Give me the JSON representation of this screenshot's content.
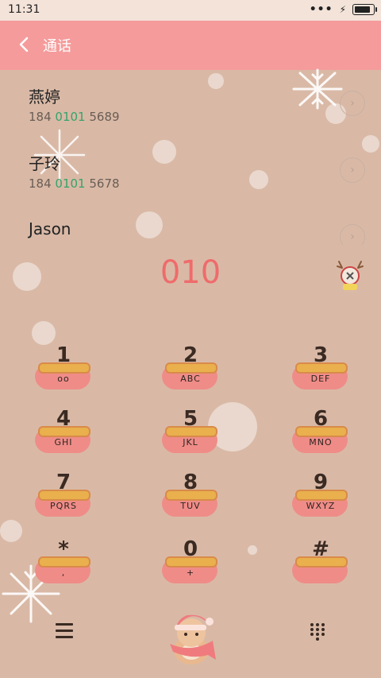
{
  "status": {
    "time": "11:31",
    "dots": "•••",
    "bolt": "⚡",
    "battery_level": 0.85
  },
  "header": {
    "title": "通话"
  },
  "contacts": [
    {
      "name": "燕婷",
      "number_pre": "184 ",
      "number_match": "0101",
      "number_post": " 5689"
    },
    {
      "name": "子玲",
      "number_pre": "184 ",
      "number_match": "0101",
      "number_post": " 5678"
    },
    {
      "name": "Jason"
    }
  ],
  "dial": {
    "number": "010"
  },
  "keypad": [
    {
      "digit": "1",
      "letters": "oo"
    },
    {
      "digit": "2",
      "letters": "ABC"
    },
    {
      "digit": "3",
      "letters": "DEF"
    },
    {
      "digit": "4",
      "letters": "GHI"
    },
    {
      "digit": "5",
      "letters": "JKL"
    },
    {
      "digit": "6",
      "letters": "MNO"
    },
    {
      "digit": "7",
      "letters": "PQRS"
    },
    {
      "digit": "8",
      "letters": "TUV"
    },
    {
      "digit": "9",
      "letters": "WXYZ"
    },
    {
      "digit": "*",
      "letters": ","
    },
    {
      "digit": "0",
      "letters": "+"
    },
    {
      "digit": "#",
      "letters": ""
    }
  ],
  "icons": {
    "back": "chevron-left-icon",
    "contact_detail": "chevron-right-icon",
    "menu": "menu-icon",
    "dialpad": "dialpad-icon",
    "deer": "reindeer-icon",
    "mascot": "hamster-mascot"
  },
  "colors": {
    "header": "#f59b9b",
    "background": "#d9b9a6",
    "dial_number": "#ef6b6b",
    "match": "#36a36a"
  }
}
